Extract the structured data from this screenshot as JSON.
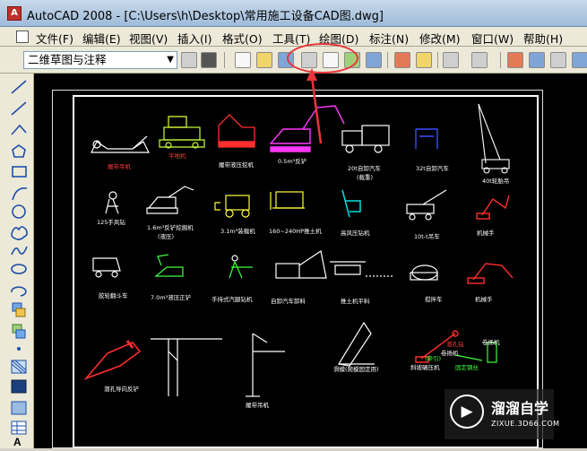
{
  "window": {
    "title": "AutoCAD 2008 - [C:\\Users\\h\\Desktop\\常用施工设备CAD图.dwg]",
    "app_icon": "autocad-logo-icon"
  },
  "menu": [
    "文件(F)",
    "编辑(E)",
    "视图(V)",
    "插入(I)",
    "格式(O)",
    "工具(T)",
    "绘图(D)",
    "标注(N)",
    "修改(M)",
    "窗口(W)",
    "帮助(H)"
  ],
  "toolbar": {
    "workspace": "二维草图与注释",
    "icons": [
      "new-icon",
      "open-icon",
      "save-icon",
      "plot-icon",
      "plot-preview-icon",
      "publish-icon",
      "3d-dwf-icon",
      "cut-icon",
      "copy-icon",
      "undo-icon",
      "redo-icon",
      "pan-icon",
      "zoom-icon",
      "properties-icon"
    ]
  },
  "draw_tools": [
    "line-icon",
    "construction-line-icon",
    "polyline-icon",
    "polygon-icon",
    "rectangle-icon",
    "arc-icon",
    "circle-icon",
    "revision-cloud-icon",
    "spline-icon",
    "ellipse-icon",
    "ellipse-arc-icon",
    "insert-block-icon",
    "make-block-icon",
    "point-icon",
    "hatch-icon",
    "gradient-icon",
    "region-icon",
    "table-icon",
    "multiline-text-icon"
  ],
  "drawing": {
    "labels": [
      {
        "text": "履带吊机",
        "color": "red"
      },
      {
        "text": "平地机",
        "color": "red"
      },
      {
        "text": "履带液压挖机",
        "color": "white"
      },
      {
        "text": "0.5m³反铲",
        "color": "white"
      },
      {
        "text": "20t自卸汽车",
        "color": "white"
      },
      {
        "text": "(载重)",
        "color": "white"
      },
      {
        "text": "32t自卸汽车",
        "color": "white"
      },
      {
        "text": "40t轮胎吊",
        "color": "white"
      },
      {
        "text": "125手风钻",
        "color": "white"
      },
      {
        "text": "1.6m³反铲挖掘机",
        "color": "white"
      },
      {
        "text": "(液压)",
        "color": "white"
      },
      {
        "text": "3.1m³装载机",
        "color": "white"
      },
      {
        "text": "160~240HP推土机",
        "color": "white"
      },
      {
        "text": "高风压钻机",
        "color": "white"
      },
      {
        "text": "10t-t吊车",
        "color": "white"
      },
      {
        "text": "机械手",
        "color": "white"
      },
      {
        "text": "胶轮翻斗车",
        "color": "white"
      },
      {
        "text": "7.0m³液压正铲",
        "color": "white"
      },
      {
        "text": "手持式汽腿钻机",
        "color": "white"
      },
      {
        "text": "自卸汽车卸料",
        "color": "white"
      },
      {
        "text": "推土机平料",
        "color": "white"
      },
      {
        "text": "搅拌车",
        "color": "white"
      },
      {
        "text": "机械手",
        "color": "white"
      },
      {
        "text": "潜孔钻",
        "color": "red"
      },
      {
        "text": "履带吊机",
        "color": "white"
      },
      {
        "text": "潜孔导向反铲",
        "color": "white"
      },
      {
        "text": "滑模(爬模固定用)",
        "color": "white"
      },
      {
        "text": "斜坡碾压机",
        "color": "white"
      },
      {
        "text": "卷扬机",
        "color": "white"
      },
      {
        "text": "卷扬机",
        "color": "white"
      },
      {
        "text": "(牵引)",
        "color": "green"
      },
      {
        "text": "固定钢丝",
        "color": "green"
      }
    ]
  },
  "watermark": {
    "logo": "play-triangle-icon",
    "name": "溜溜自学",
    "sub": "ZIXUE.3D66.COM"
  }
}
